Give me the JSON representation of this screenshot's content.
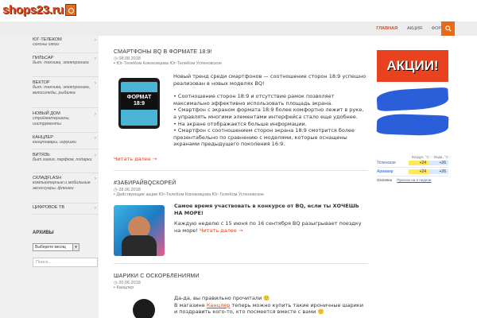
{
  "site": {
    "logo_text": "shops23.ru"
  },
  "nav": {
    "items": [
      {
        "label": "Главная",
        "active": true
      },
      {
        "label": "Акция",
        "active": false
      },
      {
        "label": "Форум",
        "active": false
      }
    ],
    "search_icon": "search-icon"
  },
  "sidebar": {
    "categories": [
      {
        "title": "ЮГ-ТЕЛЕКОМ",
        "sub": "салоны связи"
      },
      {
        "title": "ПИЛЬСАР",
        "sub": "быт. техника, электроника"
      },
      {
        "title": "ВЕКТОР",
        "sub": "быт. техника, электроника, велосипеды, рыбалка"
      },
      {
        "title": "НОВЫЙ ДОМ",
        "sub": "стройматериалы, инструменты"
      },
      {
        "title": "КАНЦЛЕР",
        "sub": "канцтовары, игрушки"
      },
      {
        "title": "ВИТЯЗЬ",
        "sub": "быт.химия, парфюм, подарки"
      },
      {
        "title": "СКЛАДFLASH",
        "sub": "компьютерные и мобильные аксессуары, флешки"
      },
      {
        "title": "ЦИФРОВОЕ ТВ",
        "sub": ""
      }
    ],
    "archive_heading": "АРХИВЫ",
    "archive_select": "Выберите месяц",
    "search_placeholder": "Поиск..."
  },
  "posts": [
    {
      "title": "СМАРТФОНЫ BQ В ФОРМАТЕ 18:9!",
      "date": "08.08.2018",
      "cats": "Юг-ТелеКом  Кококовцова  Юг-ТелеКом  Успеновское",
      "image_text": "ФОРМАТ 18:9",
      "intro": "Новый тренд среди смартфонов — соотношение сторон 18:9 успешно реализован в новых моделях BQ!",
      "bullets": [
        "Соотношение сторон 18:9 и отсутствие рамок позволяет максимально эффективно использовать площадь экрана.",
        "Смартфон с экраном формата 18:9 более комфортно лежит в руке, а управлять многими элементами интерфейса стало еще удобнее.",
        "На экране отображается больше информации.",
        "Смартфон с соотношением сторон экрана 18:9 смотрится более презентабельно по сравнению с моделями, которые оснащены экранами предыдущего поколения 16:9."
      ],
      "more": "Читать далее →"
    },
    {
      "title": "#ЗАБИРАЙBQСКОРЕЙ",
      "date": "28.06.2018",
      "cats": "Действующие акции  Юг-ТелеКом Кококовцова  Юг-ТелеКом  Успеновское",
      "lead": "Самое время участвовать в конкурсе от BQ, если ты ХОЧЕШЬ НА МОРЕ!",
      "body": "Каждую неделю с 15 июня по 16 сентября BQ разыгрывает поездку на море!",
      "more": "Читать далее →"
    },
    {
      "title": "ШАРИКИ С ОСКОРБЛЕНИЯМИ",
      "date": "20.06.2018",
      "cats": "Канцлер",
      "line1": "Да-да, вы правильно прочитали 🙂",
      "line2_pre": "В магазине ",
      "line2_link": "Канцлер",
      "line2_post": " теперь можно купить такие ироничные шарики и поздравить кого-то, кто посмеется вместе с вами 🙂"
    }
  ],
  "promo": {
    "label": "АКЦИИ!"
  },
  "weather": {
    "col1": "Воздух, °С",
    "col2": "Вода, °С",
    "rows": [
      {
        "city": "Успенское",
        "air": "+24",
        "water": "+26"
      },
      {
        "city": "Армавир",
        "air": "+24",
        "water": "+26"
      }
    ],
    "source": "Gismeteo",
    "forecast_link": "Прогноз на 2 недели"
  }
}
